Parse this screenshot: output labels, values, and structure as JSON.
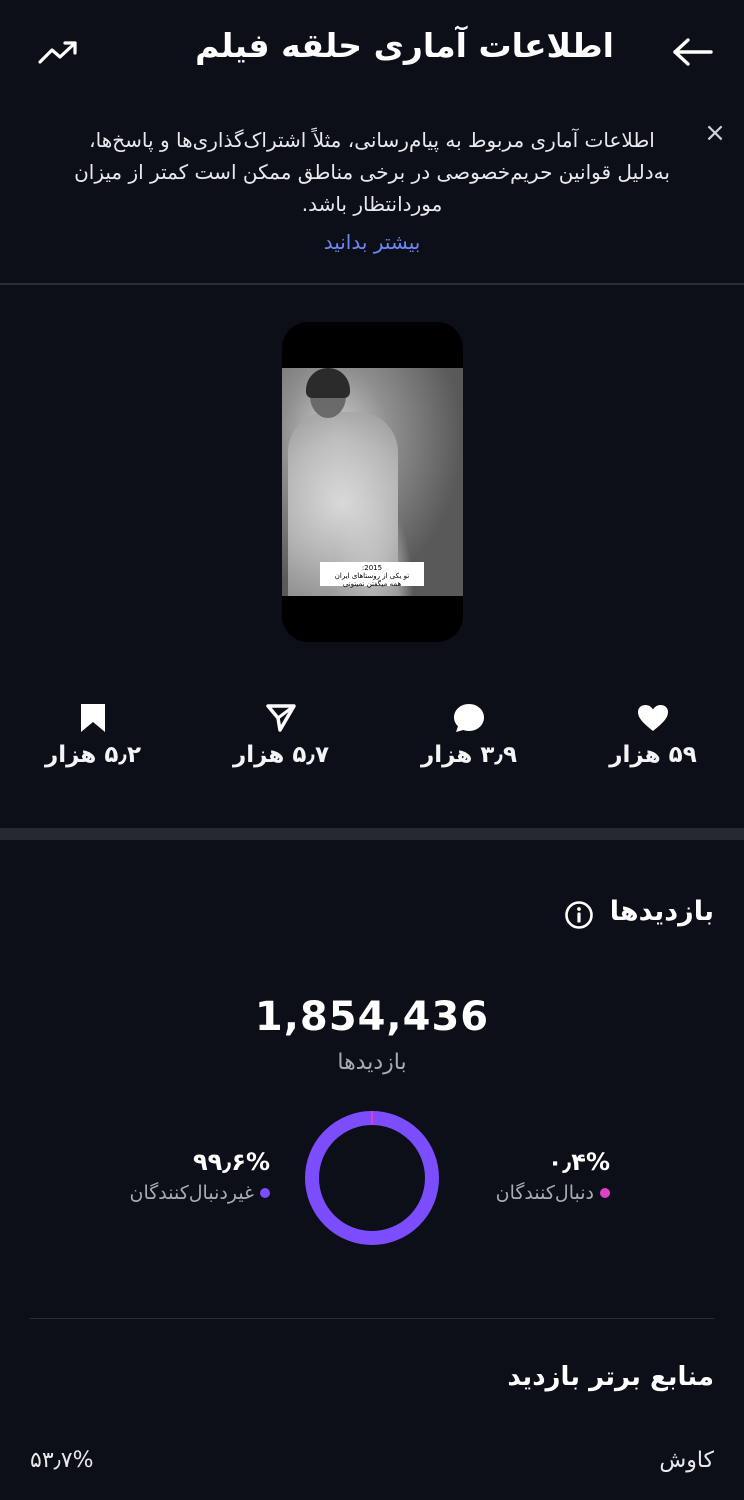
{
  "header": {
    "title": "اطلاعات آماری حلقه فیلم",
    "back_icon": "arrow-left-icon",
    "trend_icon": "trending-up-icon"
  },
  "notice": {
    "message": "اطلاعات آماری مربوط به پیام‌رسانی، مثلاً اشتراک‌گذاری‌ها و پاسخ‌ها، به‌دلیل قوانین حریم‌خصوصی در برخی مناطق ممکن است کمتر از میزان موردانتظار باشد.",
    "learn_more": "بیشتر بدانید",
    "close": "×"
  },
  "thumbnail": {
    "caption_line1": "2015:",
    "caption_line2": "تو یکی از روستاهای ایران",
    "caption_line3": "همه میگفتن نمیتونی"
  },
  "stats": {
    "likes": "۵۹ هزار",
    "comments": "۳٫۹ هزار",
    "shares": "۵٫۷ هزار",
    "saves": "۵٫۲ هزار"
  },
  "views": {
    "section_title": "بازدیدها",
    "total": "1,854,436",
    "total_label": "بازدیدها",
    "followers_pct": "۰٫۴%",
    "followers_label": "دنبال‌کنندگان",
    "nonfollowers_pct": "۹۹٫۶%",
    "nonfollowers_label": "غیردنبال‌کنندگان",
    "followers_fraction": 0.004,
    "nonfollowers_fraction": 0.996
  },
  "sources": {
    "title": "منابع برتر بازدید",
    "rows": [
      {
        "name": "کاوش",
        "pct": "۵۳٫۷%"
      }
    ]
  },
  "colors": {
    "background": "#0c0f17",
    "accent_purple": "#7c4dff",
    "accent_pink": "#e040c8",
    "link_blue": "#6d87f4"
  }
}
